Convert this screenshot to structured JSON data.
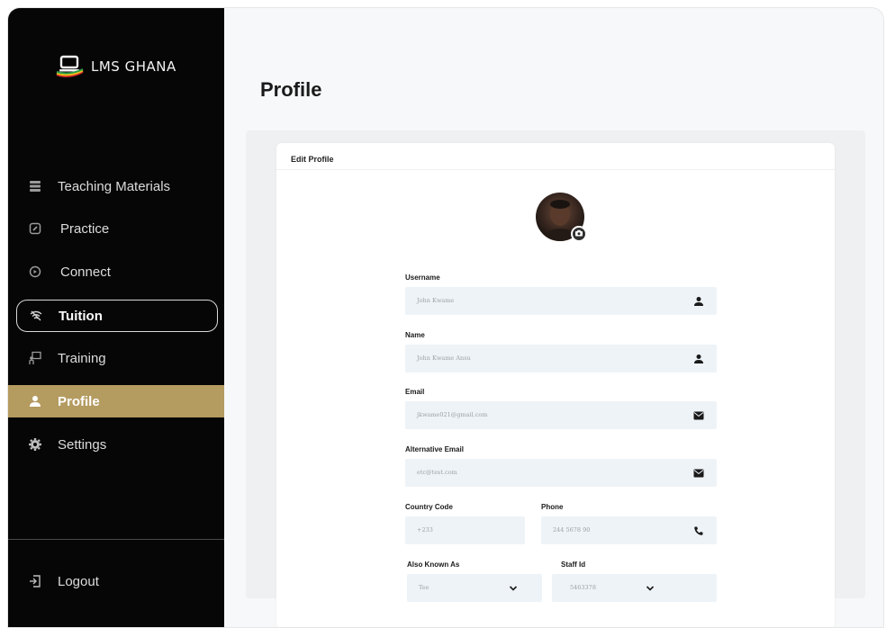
{
  "brand": {
    "name": "LMS GHANA"
  },
  "sidebar": {
    "items": [
      {
        "label": "Teaching Materials",
        "icon": "layers-icon"
      },
      {
        "label": "Practice",
        "icon": "edit-icon"
      },
      {
        "label": "Connect",
        "icon": "chat-icon"
      },
      {
        "label": "Tuition",
        "icon": "wifi-icon",
        "state": "outlined"
      },
      {
        "label": "Training",
        "icon": "training-icon"
      },
      {
        "label": "Profile",
        "icon": "user-icon",
        "state": "active"
      },
      {
        "label": "Settings",
        "icon": "gear-icon"
      }
    ],
    "logout": {
      "label": "Logout",
      "icon": "logout-icon"
    }
  },
  "page": {
    "title": "Profile"
  },
  "card": {
    "title": "Edit Profile",
    "fields": {
      "username": {
        "label": "Username",
        "value": "John Kwame",
        "icon": "user-icon"
      },
      "name": {
        "label": "Name",
        "value": "John Kwame Ansu",
        "icon": "user-icon"
      },
      "email": {
        "label": "Email",
        "value": "jkwame021@gmail.com",
        "icon": "mail-icon"
      },
      "alt_email": {
        "label": "Alternative Email",
        "value": "etc@test.com",
        "icon": "mail-icon"
      },
      "country_code": {
        "label": "Country Code",
        "value": "+233"
      },
      "phone": {
        "label": "Phone",
        "value": "244 5678 90",
        "icon": "phone-icon"
      },
      "also_known_as": {
        "label": "Also Known As",
        "value": "Tee",
        "icon": "chevron-down-icon"
      },
      "staff_id": {
        "label": "Staff Id",
        "value": "5463378",
        "icon": "chevron-down-icon"
      }
    }
  },
  "colors": {
    "sidebar_bg": "#060606",
    "active_bg": "#b49b60",
    "field_bg": "#eef3f7",
    "logo_green": "#2e9e47",
    "logo_yellow": "#f2c21b",
    "logo_red": "#d62b2b"
  }
}
